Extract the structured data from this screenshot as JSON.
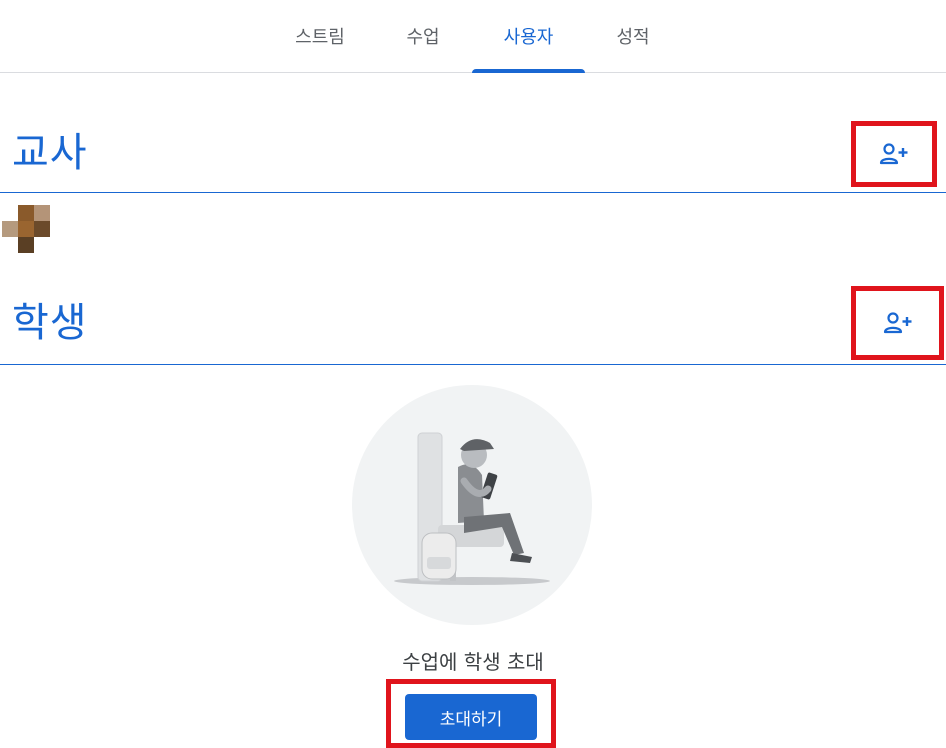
{
  "tabs": [
    {
      "label": "스트림",
      "active": false
    },
    {
      "label": "수업",
      "active": false
    },
    {
      "label": "사용자",
      "active": true
    },
    {
      "label": "성적",
      "active": false
    }
  ],
  "teachers": {
    "title": "교사",
    "add_icon": "person-add-icon"
  },
  "students": {
    "title": "학생",
    "add_icon": "person-add-icon"
  },
  "empty_state": {
    "message": "수업에 학생 초대",
    "button_label": "초대하기"
  },
  "colors": {
    "accent": "#1967d2",
    "highlight": "#e0141c",
    "divider": "#dadce0"
  }
}
